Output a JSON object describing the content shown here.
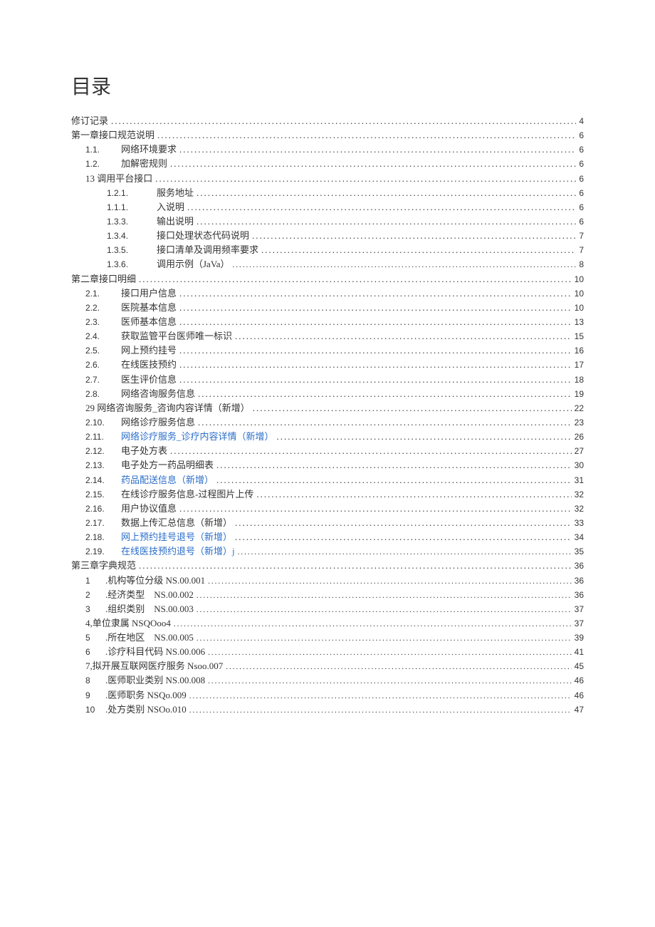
{
  "heading": "目录",
  "entries": [
    {
      "indent": 0,
      "num": "",
      "label": "修订记录",
      "page": "4",
      "link": false,
      "small": false
    },
    {
      "indent": 0,
      "num": "",
      "label": "第一章接口规范说明",
      "page": "6",
      "link": false,
      "small": false
    },
    {
      "indent": 1,
      "num": "1.1.",
      "label": "网络环境要求",
      "page": "6",
      "link": false,
      "small": false
    },
    {
      "indent": 1,
      "num": "1.2.",
      "label": "加解密规则",
      "page": "6",
      "link": false,
      "small": false
    },
    {
      "indent": 2,
      "variant": "b",
      "num": "",
      "label": "13 调用平台接口",
      "page": "6",
      "link": false,
      "small": false
    },
    {
      "indent": 2,
      "num": "1.2.1.",
      "label": "服务地址",
      "page": "6",
      "link": false,
      "small": false
    },
    {
      "indent": 2,
      "num": "1.1.1.",
      "label": "入说明",
      "page": "6",
      "link": false,
      "small": false
    },
    {
      "indent": 2,
      "num": "1.3.3.",
      "label": "输出说明",
      "page": "6",
      "link": false,
      "small": false
    },
    {
      "indent": 2,
      "num": "1.3.4.",
      "label": "接口处理状态代码说明",
      "page": "7",
      "link": false,
      "small": false
    },
    {
      "indent": 2,
      "num": "1.3.5.",
      "label": "接口清单及调用频率要求",
      "page": "7",
      "link": false,
      "small": false
    },
    {
      "indent": 2,
      "num": "1.3.6.",
      "label": "调用示例（JaVa）",
      "page": "8",
      "link": false,
      "small": true
    },
    {
      "indent": 0,
      "num": "",
      "label": "第二章接口明细",
      "page": "10",
      "link": false,
      "small": false
    },
    {
      "indent": 1,
      "num": "2.1.",
      "label": "接口用户信息",
      "page": "10",
      "link": false,
      "small": false
    },
    {
      "indent": 1,
      "num": "2.2.",
      "label": "医院基本信息",
      "page": "10",
      "link": false,
      "small": false
    },
    {
      "indent": 1,
      "num": "2.3.",
      "label": "医师基本信息",
      "page": "13",
      "link": false,
      "small": false
    },
    {
      "indent": 1,
      "num": "2.4.",
      "label": "获取监管平台医师唯一标识",
      "page": "15",
      "link": false,
      "small": false
    },
    {
      "indent": 1,
      "num": "2.5.",
      "label": "网上预约挂号",
      "page": "16",
      "link": false,
      "small": false
    },
    {
      "indent": 1,
      "num": "2.6.",
      "label": "在线医技预约",
      "page": "17",
      "link": false,
      "small": false
    },
    {
      "indent": 1,
      "num": "2.7.",
      "label": "医生评价信息",
      "page": "18",
      "link": false,
      "small": false
    },
    {
      "indent": 1,
      "num": "2.8.",
      "label": "网络咨询服务信息",
      "page": "19",
      "link": false,
      "small": false
    },
    {
      "indent": 2,
      "variant": "b",
      "num": "",
      "label": "29 网络咨询服务_咨询内容详情（新增）",
      "page": "22",
      "link": false,
      "small": false
    },
    {
      "indent": 1,
      "num": "2.10.",
      "label": "网络诊疗服务信息",
      "page": "23",
      "link": false,
      "small": false
    },
    {
      "indent": 1,
      "num": "2.11.",
      "label": "网络诊疗服务_诊疗内容详情（新增）",
      "page": "26",
      "link": true,
      "small": false
    },
    {
      "indent": 1,
      "num": "2.12.",
      "label": "电子处方表",
      "page": "27",
      "link": false,
      "small": false
    },
    {
      "indent": 1,
      "num": "2.13.",
      "label": "电子处方一药品明细表",
      "page": "30",
      "link": false,
      "small": false
    },
    {
      "indent": 1,
      "num": "2.14.",
      "label": "药品配送信息（新增）",
      "page": "31",
      "link": true,
      "small": false
    },
    {
      "indent": 1,
      "num": "2.15.",
      "label": "在线诊疗服务信息-过程图片上传",
      "page": "32",
      "link": false,
      "small": false
    },
    {
      "indent": 1,
      "num": "2.16.",
      "label": "用户协议值息",
      "page": "32",
      "link": false,
      "small": false
    },
    {
      "indent": 1,
      "num": "2.17.",
      "label": "数据上传汇总信息（新增）",
      "page": "33",
      "link": false,
      "small": false
    },
    {
      "indent": 1,
      "num": "2.18.",
      "label": "网上预约挂号退号（新增）",
      "page": "34",
      "link": true,
      "small": false
    },
    {
      "indent": 1,
      "num": "2.19.",
      "label": "在线医技预约退号（新增）j",
      "page": "35",
      "link": true,
      "small": true
    },
    {
      "indent": 0,
      "num": "",
      "label": "第三章字典规范",
      "page": "36",
      "link": false,
      "small": false
    },
    {
      "indent": 3,
      "num": "1",
      "label": ".机构等位分级 NS.00.001",
      "page": "36",
      "link": false,
      "small": true
    },
    {
      "indent": 3,
      "num": "2",
      "label": ".经济类型 NS.00.002",
      "page": "36",
      "link": false,
      "small": true
    },
    {
      "indent": 3,
      "num": "3",
      "label": ".组织类别 NS.00.003",
      "page": "37",
      "link": false,
      "small": true
    },
    {
      "indent": 3,
      "num": "",
      "label": "4,单位隶属 NSQOoo4",
      "page": "37",
      "link": false,
      "small": true
    },
    {
      "indent": 3,
      "num": "5",
      "label": ".所在地区 NS.00.005",
      "page": "39",
      "link": false,
      "small": true
    },
    {
      "indent": 3,
      "num": "6",
      "label": ".诊疗科目代码 NS.00.006",
      "page": "41",
      "link": false,
      "small": true
    },
    {
      "indent": 3,
      "num": "",
      "label": "7,拟开展互联网医疗服务 Nsoo.007",
      "page": "45",
      "link": false,
      "small": true
    },
    {
      "indent": 3,
      "num": "8",
      "label": ".医师职业类别 NS.00.008",
      "page": "46",
      "link": false,
      "small": true
    },
    {
      "indent": 3,
      "num": "9",
      "label": ".医师职务 NSQo.009",
      "page": "46",
      "link": false,
      "small": true
    },
    {
      "indent": 3,
      "num": "10",
      "label": ".处方类别 NSOo.010",
      "page": "47",
      "link": false,
      "small": true
    }
  ]
}
